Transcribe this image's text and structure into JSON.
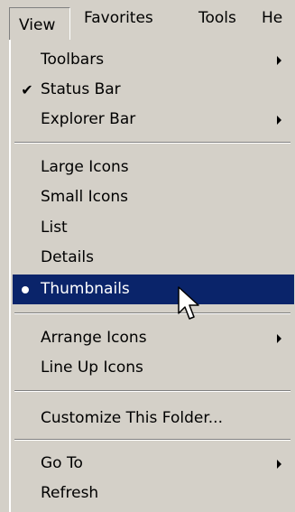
{
  "menubar": {
    "items": [
      {
        "label": "View"
      },
      {
        "label": "Favorites"
      },
      {
        "label": "Tools"
      },
      {
        "label": "He"
      }
    ]
  },
  "menu": {
    "items": [
      {
        "label": "Toolbars",
        "submenu": true
      },
      {
        "label": "Status Bar",
        "checked": true
      },
      {
        "label": "Explorer Bar",
        "submenu": true
      },
      {
        "label": "Large Icons"
      },
      {
        "label": "Small Icons"
      },
      {
        "label": "List"
      },
      {
        "label": "Details"
      },
      {
        "label": "Thumbnails",
        "selected": true,
        "radio": true
      },
      {
        "label": "Arrange Icons",
        "submenu": true
      },
      {
        "label": "Line Up Icons"
      },
      {
        "label": "Customize This Folder..."
      },
      {
        "label": "Go To",
        "submenu": true
      },
      {
        "label": "Refresh"
      }
    ]
  },
  "icons": {
    "check": "checkmark-icon",
    "radio": "radio-dot-icon",
    "submenu": "submenu-arrow-icon",
    "cursor": "mouse-pointer-icon"
  },
  "colors": {
    "menu_bg": "#d4d0c8",
    "highlight_bg": "#0a246a",
    "highlight_text": "#ffffff"
  }
}
